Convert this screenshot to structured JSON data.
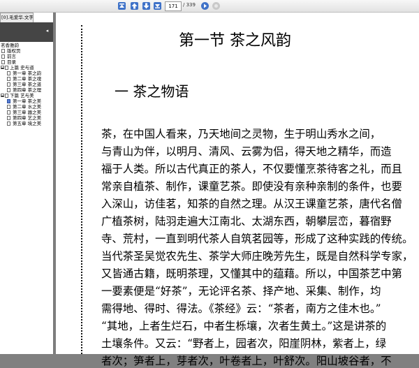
{
  "toolbar": {
    "page_current": "171",
    "page_total": "/ 339",
    "buttons": [
      "first-page-icon",
      "prev-page-icon",
      "next-page-icon",
      "last-page-icon",
      "go-icon",
      "stop-icon"
    ]
  },
  "panel": {
    "tab_label": "[0].毛爱华.文字版",
    "collapse_glyph": "◂",
    "tree": [
      {
        "label": "茗香雅韵",
        "level": 0,
        "kind": "root"
      },
      {
        "label": "版权页",
        "level": 1,
        "kind": "doc"
      },
      {
        "label": "前言",
        "level": 1,
        "kind": "doc"
      },
      {
        "label": "目录",
        "level": 1,
        "kind": "doc"
      },
      {
        "label": "上篇  史与道",
        "level": 1,
        "kind": "folder"
      },
      {
        "label": "第一章  茶之韵",
        "level": 2,
        "kind": "doc"
      },
      {
        "label": "第二章  茶之魂",
        "level": 2,
        "kind": "doc"
      },
      {
        "label": "第三章  茶之道",
        "level": 2,
        "kind": "doc"
      },
      {
        "label": "第四章  茶之理",
        "level": 2,
        "kind": "doc"
      },
      {
        "label": "下篇  艺与美",
        "level": 1,
        "kind": "folder"
      },
      {
        "label": "第一章  茶之美",
        "level": 2,
        "kind": "doc-selected"
      },
      {
        "label": "第二章  水之美",
        "level": 2,
        "kind": "doc"
      },
      {
        "label": "第三章  器之美",
        "level": 2,
        "kind": "doc"
      },
      {
        "label": "第四章  艺之美",
        "level": 2,
        "kind": "doc"
      },
      {
        "label": "第五章  境之美",
        "level": 2,
        "kind": "doc"
      }
    ]
  },
  "document": {
    "section_title": "第一节    茶之风韵",
    "subtitle": "一  茶之物语",
    "lines": [
      "    茶，在中国人看来，乃天地间之灵物，生于明山秀水之间，",
      "与青山为伴，以明月、清风、云雾为侣，得天地之精华，而造",
      "福于人类。所以古代真正的茶人，不仅要懂烹茶待客之礼，而且",
      "常亲自植茶、制作，课童艺茶。即使没有亲种亲制的条件，也要",
      "入深山，访佳茗，知茶的自然之理。从汉王课童艺茶，唐代名僧",
      "广植茶树，陆羽走遍大江南北、太湖东西，朝攀层峦，暮宿野",
      "寺、荒村，一直到明代茶人自筑茗园等，形成了这种实践的传统。",
      "当代茶圣吴觉农先生、茶学大师庄晚芳先生，既是自然科学专家，",
      "又皆通古籍，既明茶理，又懂其中的蕴藉。所以，中国茶艺中第",
      "一要素便是“好茶”，无论评名茶、择产地、采集、制作，均",
      "需得地、得时、得法。《茶经》云：“茶者，南方之佳木也。”",
      "“其地，上者生烂石，中者生栎壤，次者生黄土。”这是讲茶的",
      "土壤条件。又云：“野者上，园者次，阳崖阴林，紫者上，绿",
      "者次；笋者上，芽者次，叶卷者上，叶舒次。阳山坡谷者，不"
    ]
  }
}
